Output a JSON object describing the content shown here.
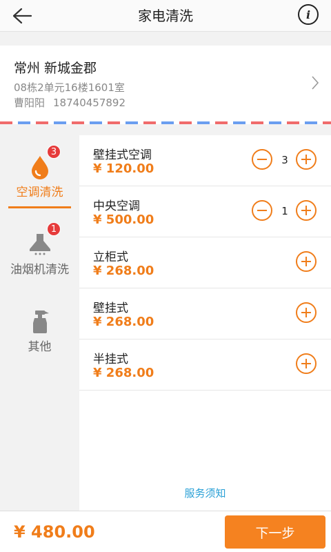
{
  "header": {
    "title": "家电清洗",
    "back_icon": "back-arrow-icon",
    "info_icon": "info-icon",
    "info_glyph": "i"
  },
  "address": {
    "name": "常州 新城金郡",
    "detail": "08栋2单元16楼1601室",
    "contact_name": "曹阳阳",
    "contact_phone": "18740457892"
  },
  "sidebar": {
    "items": [
      {
        "label": "空调清洗",
        "badge": "3",
        "icon": "water-drop-icon",
        "active": true
      },
      {
        "label": "油烟机清洗",
        "badge": "1",
        "icon": "range-hood-icon",
        "active": false
      },
      {
        "label": "其他",
        "badge": "",
        "icon": "spray-bottle-icon",
        "active": false
      }
    ]
  },
  "items": [
    {
      "name": "壁挂式空调",
      "price": "¥ 120.00",
      "qty": "3"
    },
    {
      "name": "中央空调",
      "price": "¥ 500.00",
      "qty": "1"
    },
    {
      "name": "立柜式",
      "price": "¥ 268.00",
      "qty": ""
    },
    {
      "name": "壁挂式",
      "price": "¥ 268.00",
      "qty": ""
    },
    {
      "name": "半挂式",
      "price": "¥ 268.00",
      "qty": ""
    }
  ],
  "notice": "服务须知",
  "footer": {
    "total": "¥ 480.00",
    "next_label": "下一步"
  },
  "colors": {
    "accent": "#f07d1a",
    "button": "#f58220",
    "badge": "#e63b3b",
    "link": "#29a0d6"
  }
}
